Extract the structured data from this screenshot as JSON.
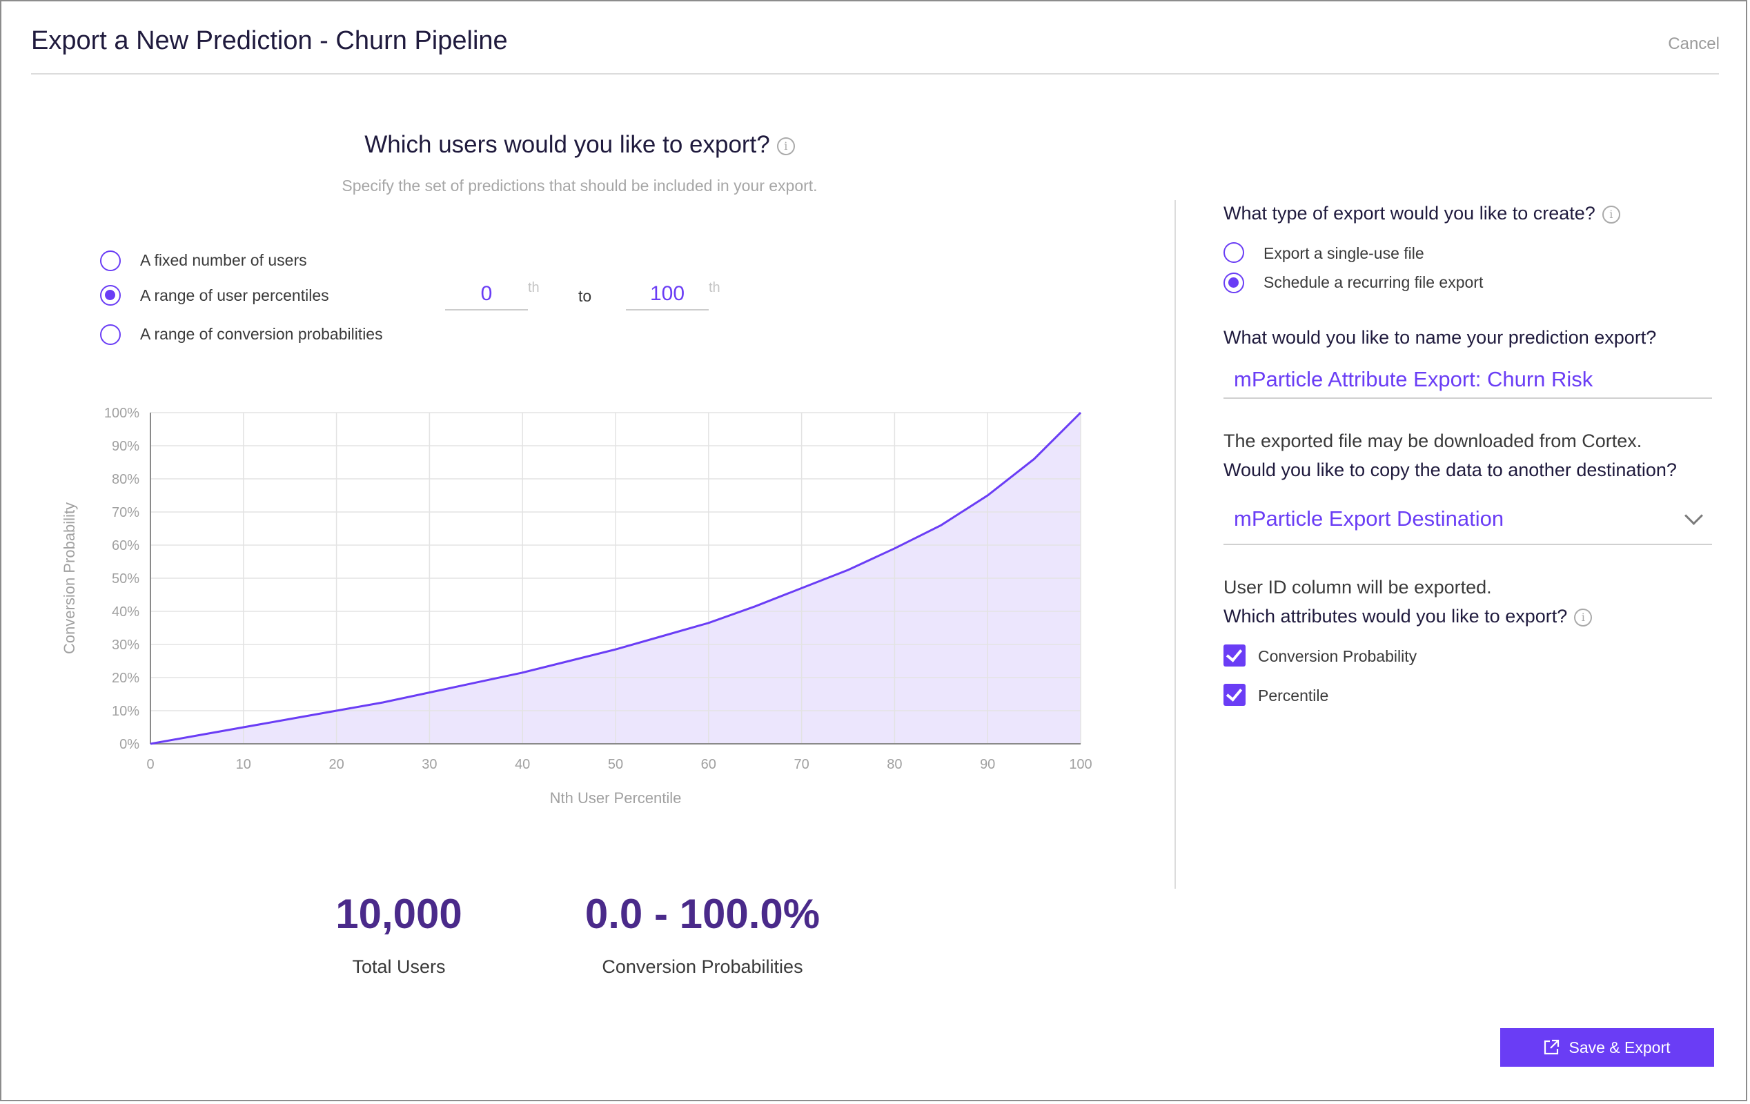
{
  "header": {
    "title": "Export a New Prediction - Churn Pipeline",
    "cancel_label": "Cancel"
  },
  "left": {
    "question": "Which users would you like to export?",
    "subtitle": "Specify the set of predictions that should be included in your export.",
    "options": [
      {
        "label": "A fixed number of users",
        "selected": false
      },
      {
        "label": "A range of user percentiles",
        "selected": true
      },
      {
        "label": "A range of conversion probabilities",
        "selected": false
      }
    ],
    "range": {
      "from": "0",
      "to": "100",
      "suffix": "th",
      "to_label": "to"
    }
  },
  "chart_data": {
    "type": "area",
    "xlabel": "Nth User Percentile",
    "ylabel": "Conversion Probability",
    "xlim": [
      0,
      100
    ],
    "ylim": [
      0,
      100
    ],
    "x_ticks": [
      "0",
      "10",
      "20",
      "30",
      "40",
      "50",
      "60",
      "70",
      "80",
      "90",
      "100"
    ],
    "y_ticks": [
      "0%",
      "10%",
      "20%",
      "30%",
      "40%",
      "50%",
      "60%",
      "70%",
      "80%",
      "90%",
      "100%"
    ],
    "grid": true,
    "x": [
      0,
      5,
      10,
      15,
      20,
      25,
      30,
      35,
      40,
      45,
      50,
      55,
      60,
      65,
      70,
      75,
      80,
      85,
      90,
      95,
      100
    ],
    "y": [
      0,
      2.5,
      5,
      7.5,
      10,
      12.5,
      15.5,
      18.5,
      21.5,
      25,
      28.5,
      32.5,
      36.5,
      41.5,
      47,
      52.5,
      59,
      66,
      75,
      86,
      100
    ],
    "line_color": "#6a3df5",
    "fill_color": "#ece6fd"
  },
  "stats": [
    {
      "value": "10,000",
      "label": "Total Users"
    },
    {
      "value": "0.0 - 100.0%",
      "label": "Conversion Probabilities"
    }
  ],
  "right": {
    "type_question": "What type of export would you like to create?",
    "type_options": [
      {
        "label": "Export a single-use file",
        "selected": false
      },
      {
        "label": "Schedule a recurring file export",
        "selected": true
      }
    ],
    "name_question": "What would you like to name your prediction export?",
    "name_value": "mParticle Attribute Export: Churn Risk",
    "download_note": "The exported file may be downloaded from Cortex.",
    "dest_question": "Would you like to copy the data to another destination?",
    "dest_value": "mParticle Export Destination",
    "userid_note": "User ID column will be exported.",
    "attr_question": "Which attributes would you like to export?",
    "attributes": [
      {
        "label": "Conversion Probability",
        "checked": true
      },
      {
        "label": "Percentile",
        "checked": true
      }
    ]
  },
  "footer": {
    "save_label": "Save & Export"
  },
  "colors": {
    "accent": "#6a3df5",
    "stat": "#4a2a8a"
  }
}
